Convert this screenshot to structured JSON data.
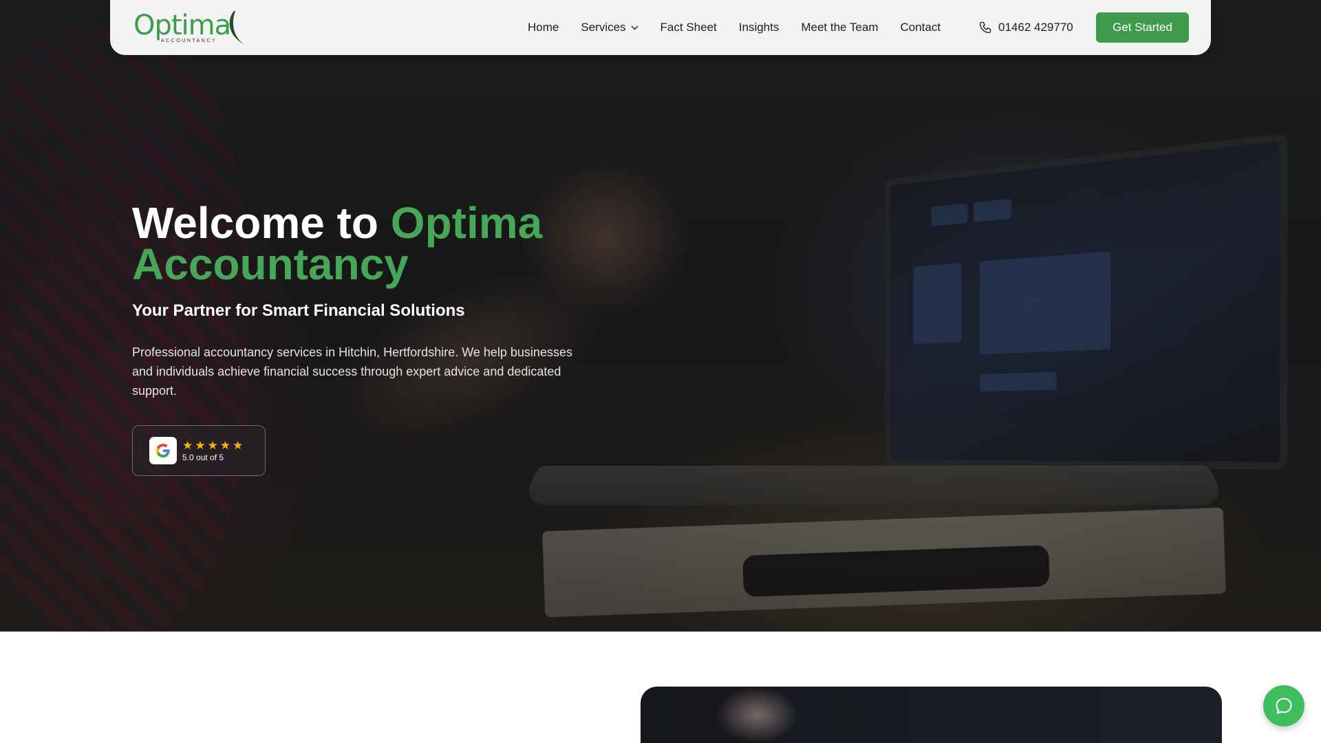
{
  "brand": {
    "logo_text": "Optima",
    "logo_subtext": "ACCOUNTANCY",
    "accent_color": "#3e9b4b"
  },
  "nav": {
    "links": [
      {
        "label": "Home"
      },
      {
        "label": "Services",
        "has_dropdown": true
      },
      {
        "label": "Fact Sheet"
      },
      {
        "label": "Insights"
      },
      {
        "label": "Meet the Team"
      },
      {
        "label": "Contact"
      }
    ],
    "phone": "01462 429770",
    "cta_label": "Get Started"
  },
  "hero": {
    "title_prefix": "Welcome to",
    "title_accent": "Optima Accountancy",
    "subtitle": "Your Partner for Smart Financial Solutions",
    "description": "Professional accountancy services in Hitchin, Hertfordshire. We help businesses and individuals achieve financial success through expert advice and dedicated support.",
    "review": {
      "provider_icon": "google-icon",
      "stars": 5,
      "rating_text": "5.0 out of 5"
    }
  },
  "chat": {
    "icon": "chat-bubble-icon"
  }
}
